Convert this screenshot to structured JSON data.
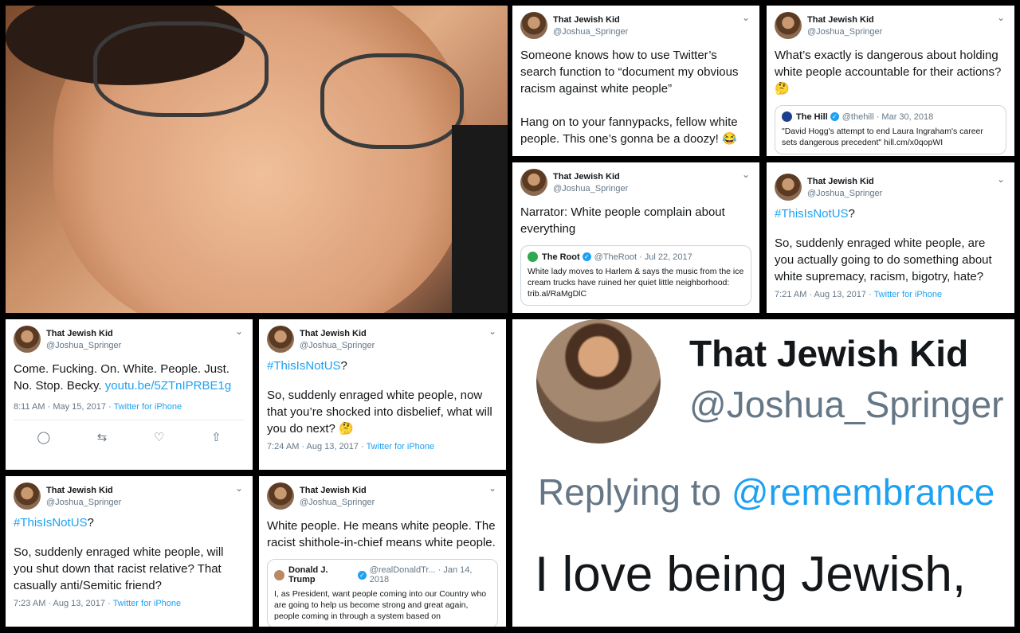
{
  "profile": {
    "name": "That Jewish Kid",
    "handle": "@Joshua_Springer"
  },
  "tweets": {
    "t1": {
      "text": "Someone knows how to use Twitter’s search function to “document my obvious racism against white people”\n\nHang on to your fannypacks, fellow white people. This one’s gonna be a doozy!",
      "emoji": "😂"
    },
    "t2": {
      "text": "What’s exactly is dangerous about holding white people accountable for their actions?",
      "emoji": "🤔",
      "quote": {
        "name": "The Hill",
        "handle": "@thehill · Mar 30, 2018",
        "text": "\"David Hogg's attempt to end Laura Ingraham's career sets dangerous precedent\" hill.cm/x0qopWI"
      }
    },
    "t3": {
      "text": "Narrator: White people complain about everything",
      "quote": {
        "name": "The Root",
        "handle": "@TheRoot · Jul 22, 2017",
        "text": "White lady moves to Harlem & says the music from the ice cream trucks have ruined her quiet little neighborhood: trib.al/RaMgDlC"
      }
    },
    "t4": {
      "hashtag": "#ThisIsNotUS",
      "after_tag": "?",
      "text": "So, suddenly enraged white people, are you actually going to do something about white supremacy, racism, bigotry, hate?",
      "time": "7:21 AM · Aug 13, 2017 · ",
      "source": "Twitter for iPhone"
    },
    "t5": {
      "text": "Come. Fucking. On. White. People. Just. No. Stop. Becky. ",
      "link": "youtu.be/5ZTnIPRBE1g",
      "time": "8:11 AM · May 15, 2017 · ",
      "source": "Twitter for iPhone"
    },
    "t6": {
      "hashtag": "#ThisIsNotUS",
      "after_tag": "?",
      "text": "So, suddenly enraged white people, now that you’re shocked into disbelief, what will you do next?",
      "emoji": "🤔",
      "time": "7:24 AM · Aug 13, 2017 · ",
      "source": "Twitter for iPhone"
    },
    "t7": {
      "hashtag": "#ThisIsNotUS",
      "after_tag": "?",
      "text": "So, suddenly enraged white people, will you shut down that racist relative? That casually anti/Semitic friend?",
      "time": "7:23 AM · Aug 13, 2017 · ",
      "source": "Twitter for iPhone"
    },
    "t8": {
      "text": "White people. He means white people. The racist shithole-in-chief means white people.",
      "quote": {
        "name": "Donald J. Trump",
        "handle": "@realDonaldTr... · Jan 14, 2018",
        "text": "I, as President, want people coming into our Country who are going to help us become strong and great again, people coming in through a system based on"
      }
    }
  },
  "zoom": {
    "name": "That Jewish Kid",
    "handle": "@Joshua_Springer",
    "replying": "Replying to ",
    "replying_to": "@remembrance",
    "text": "I love being Jewish,"
  },
  "icons": [
    "chevron-down-icon",
    "reply-icon",
    "retweet-icon",
    "like-icon",
    "share-icon",
    "verified-icon"
  ],
  "colors": {
    "link": "#1da1f2",
    "secondary": "#657786"
  }
}
